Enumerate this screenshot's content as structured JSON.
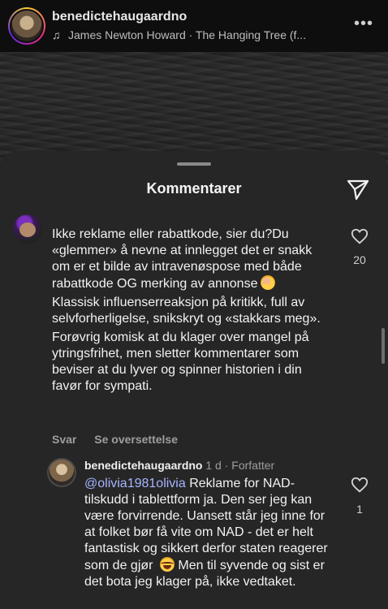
{
  "post": {
    "username": "benedictehaugaardno",
    "music": "James Newton Howard · The Hanging Tree (f...",
    "more_label": "•••"
  },
  "sheet": {
    "title": "Kommentarer"
  },
  "comment": {
    "paragraphs": [
      "Ikke reklame eller rabattkode, sier du?Du «glemmer» å nevne at innlegget det er snakk om er et bilde av intravenøspose med både rabattkode OG merking av annonse",
      "Klassisk influenserreaksjon på kritikk, full av selvforherligelse, snikskryt og «stakkars meg».",
      "Forøvrig komisk at du klager over mangel på ytringsfrihet, men sletter kommentarer som beviser at du lyver og spinner historien i din favør for sympati."
    ],
    "likes": "20",
    "reply_label": "Svar",
    "translate_label": "Se oversettelse"
  },
  "reply": {
    "username": "benedictehaugaardno",
    "time": "1 d",
    "author_badge": "Forfatter",
    "separator": "·",
    "mention": "@olivia1981olivia",
    "text_1": " Reklame for NAD-tilskudd i tablettform ja. Den ser jeg kan være forvirrende. Uansett står jeg inne for at folket bør få vite om NAD - det er helt fantastisk og sikkert derfor staten reagerer som de gjør",
    "text_2": " Men til syvende og sist er det bota jeg klager på, ikke vedtaket.",
    "likes": "1"
  },
  "icons": {
    "music": "music-note-icon",
    "share": "paper-plane-icon",
    "like": "heart-outline-icon"
  }
}
